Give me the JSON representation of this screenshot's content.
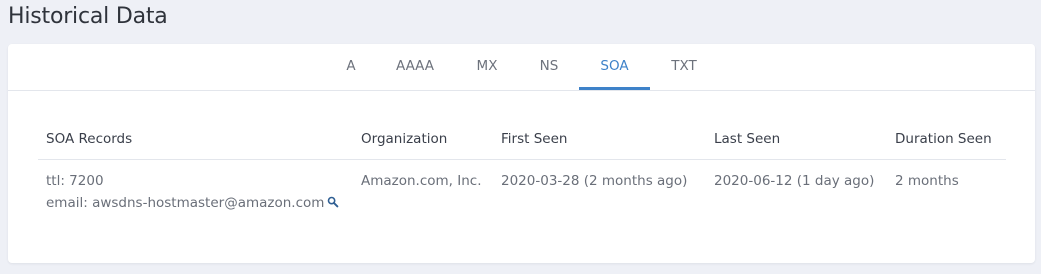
{
  "page": {
    "title": "Historical Data"
  },
  "tabs": [
    {
      "label": "A"
    },
    {
      "label": "AAAA"
    },
    {
      "label": "MX"
    },
    {
      "label": "NS"
    },
    {
      "label": "SOA",
      "active": true
    },
    {
      "label": "TXT"
    }
  ],
  "table": {
    "columns": [
      "SOA Records",
      "Organization",
      "First Seen",
      "Last Seen",
      "Duration Seen"
    ],
    "rows": [
      {
        "ttl": "ttl: 7200",
        "email": "email: awsdns-hostmaster@amazon.com",
        "organization": "Amazon.com, Inc.",
        "first_seen": "2020-03-28 (2 months ago)",
        "last_seen": "2020-06-12 (1 day ago)",
        "duration": "2 months"
      }
    ]
  },
  "icons": {
    "email_lookup": "search-icon"
  },
  "colors": {
    "accent": "#3e82c9",
    "background": "#eef0f6",
    "card": "#ffffff"
  }
}
